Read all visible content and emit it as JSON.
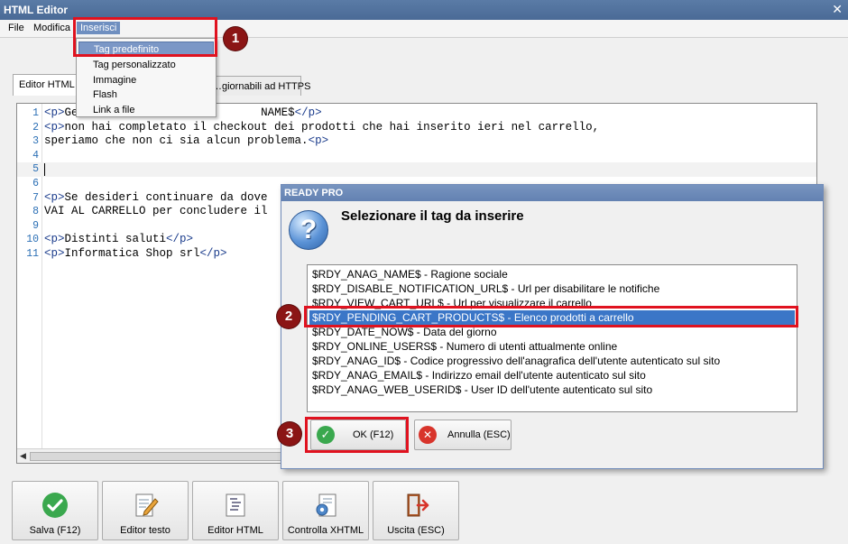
{
  "window": {
    "title": "HTML Editor",
    "close_glyph": "✕"
  },
  "menu": {
    "items": [
      "File",
      "Modifica",
      "Inserisci"
    ]
  },
  "insert_menu": {
    "items": [
      "Tag predefinito",
      "Tag personalizzato",
      "Immagine",
      "Flash",
      "Link a file"
    ],
    "selected_index": 0
  },
  "tabs": [
    {
      "label": "Editor HTML"
    },
    {
      "label": "…giornabili ad HTTPS"
    }
  ],
  "editor": {
    "lines": [
      {
        "n": "1",
        "parts": [
          [
            "t",
            "<p>"
          ],
          [
            "x",
            "Ge"
          ],
          [
            "x",
            "                           "
          ],
          [
            "x",
            "NAME$"
          ],
          [
            "t",
            "</p>"
          ]
        ]
      },
      {
        "n": "2",
        "parts": [
          [
            "t",
            "<p>"
          ],
          [
            "x",
            "non hai completato il checkout dei prodotti che hai inserito ieri nel carrello,"
          ]
        ]
      },
      {
        "n": "3",
        "parts": [
          [
            "x",
            "speriamo che non ci sia alcun problema."
          ],
          [
            "t",
            "<p>"
          ]
        ]
      },
      {
        "n": "4",
        "parts": []
      },
      {
        "n": "5",
        "parts": []
      },
      {
        "n": "6",
        "parts": []
      },
      {
        "n": "7",
        "parts": [
          [
            "t",
            "<p>"
          ],
          [
            "x",
            "Se desideri continuare da dove"
          ]
        ]
      },
      {
        "n": "8",
        "parts": [
          [
            "x",
            "VAI AL CARRELLO per concludere il"
          ]
        ]
      },
      {
        "n": "9",
        "parts": []
      },
      {
        "n": "10",
        "parts": [
          [
            "t",
            "<p>"
          ],
          [
            "x",
            "Distinti saluti"
          ],
          [
            "t",
            "</p>"
          ]
        ]
      },
      {
        "n": "11",
        "parts": [
          [
            "t",
            "<p>"
          ],
          [
            "x",
            "Informatica Shop srl"
          ],
          [
            "t",
            "</p>"
          ]
        ]
      }
    ],
    "current_line": "5"
  },
  "dialog": {
    "title": "READY PRO",
    "heading": "Selezionare il tag da inserire",
    "items": [
      "$RDY_ANAG_NAME$ - Ragione sociale",
      "$RDY_DISABLE_NOTIFICATION_URL$ - Url per disabilitare le notifiche",
      "$RDY_VIEW_CART_URL$ - Url per visualizzare il carrello",
      "$RDY_PENDING_CART_PRODUCTS$ - Elenco prodotti a carrello",
      "$RDY_DATE_NOW$ - Data del giorno",
      "$RDY_ONLINE_USERS$ - Numero di utenti attualmente online",
      "$RDY_ANAG_ID$ - Codice progressivo dell'anagrafica dell'utente autenticato sul sito",
      "$RDY_ANAG_EMAIL$ - Indirizzo email dell'utente autenticato sul sito",
      "$RDY_ANAG_WEB_USERID$ - User ID dell'utente autenticato sul sito"
    ],
    "selected_index": 3,
    "ok_label": "OK (F12)",
    "cancel_label": "Annulla (ESC)",
    "question_glyph": "?"
  },
  "toolbar": {
    "buttons": [
      {
        "label": "Salva (F12)",
        "icon": "check-icon"
      },
      {
        "label": "Editor testo",
        "icon": "pencil-document-icon"
      },
      {
        "label": "Editor HTML",
        "icon": "html-document-icon"
      },
      {
        "label": "Controlla XHTML",
        "icon": "gear-document-icon"
      },
      {
        "label": "Uscita (ESC)",
        "icon": "exit-door-icon"
      }
    ]
  },
  "badges": [
    "1",
    "2",
    "3"
  ],
  "colors": {
    "highlight": "#e0121f",
    "badge": "#8b1515",
    "selection": "#3b76c7"
  }
}
